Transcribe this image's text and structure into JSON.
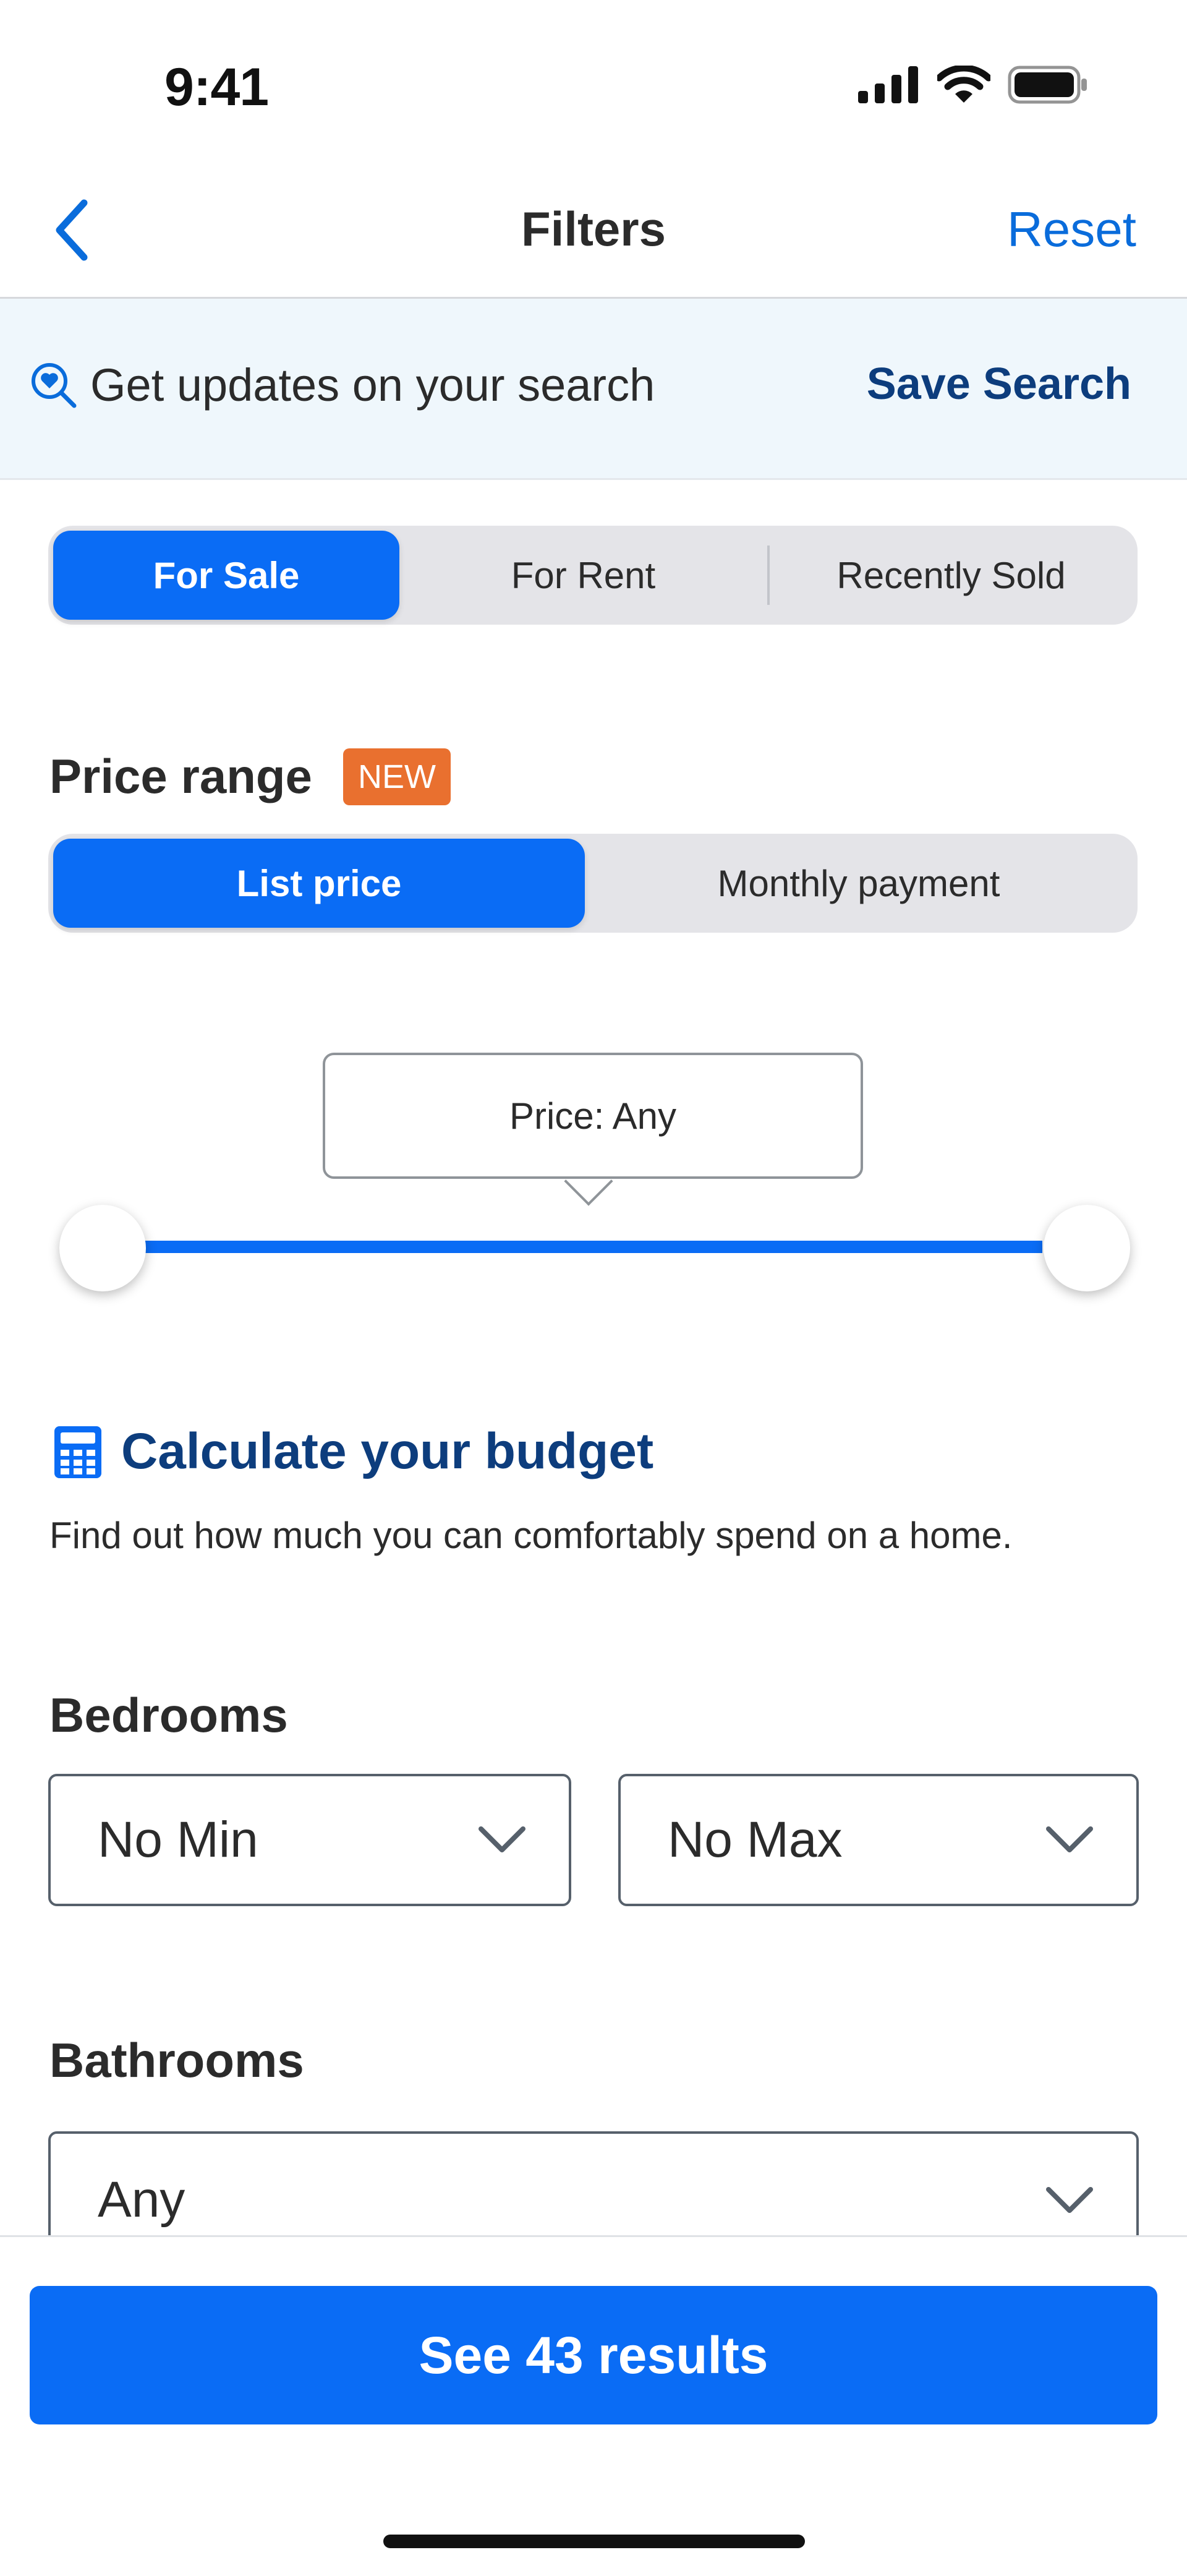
{
  "status_bar": {
    "time": "9:41"
  },
  "nav": {
    "title": "Filters",
    "reset_label": "Reset"
  },
  "banner": {
    "text": "Get updates on your search",
    "save_label": "Save Search"
  },
  "listing_type": {
    "options": [
      "For Sale",
      "For Rent",
      "Recently Sold"
    ],
    "selected": "For Sale"
  },
  "price_range": {
    "title": "Price range",
    "badge": "NEW",
    "modes": [
      "List price",
      "Monthly payment"
    ],
    "selected_mode": "List price",
    "tooltip": "Price: Any"
  },
  "budget": {
    "link_label": "Calculate your budget",
    "description": "Find out how much you can comfortably spend on a home."
  },
  "bedrooms": {
    "title": "Bedrooms",
    "min": "No Min",
    "max": "No Max"
  },
  "bathrooms": {
    "title": "Bathrooms",
    "value": "Any"
  },
  "footer": {
    "results_label": "See 43 results"
  },
  "colors": {
    "accent": "#0a6cf5",
    "link": "#0a6cdb",
    "dark_link": "#0d3d7d",
    "badge": "#e9702f",
    "banner_bg": "#eff7fc"
  },
  "icons": [
    "back-chevron-icon",
    "search-heart-icon",
    "calculator-icon",
    "chevron-down-icon",
    "signal-icon",
    "wifi-icon",
    "battery-icon"
  ]
}
